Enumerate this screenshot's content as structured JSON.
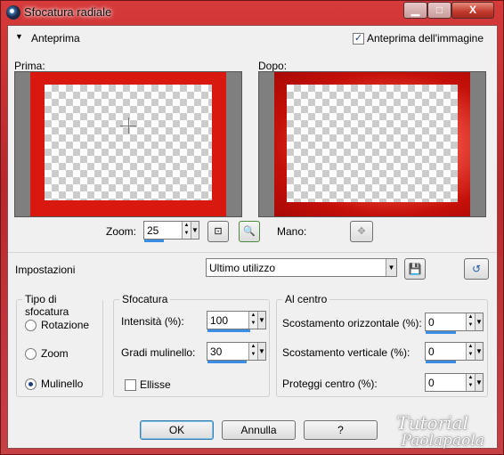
{
  "window": {
    "title": "Sfocatura radiale",
    "caption_min": "▁",
    "caption_max": "□",
    "caption_close": "X"
  },
  "preview": {
    "section_label": "Anteprima",
    "toggle_label": "Anteprima dell'immagine",
    "toggle_checked": true,
    "before_label": "Prima:",
    "after_label": "Dopo:"
  },
  "zoom": {
    "label": "Zoom:",
    "value": "25",
    "hand_label": "Mano:"
  },
  "settings": {
    "label": "Impostazioni",
    "preset": "Ultimo utilizzo"
  },
  "blur_type": {
    "title": "Tipo di sfocatura",
    "options": [
      "Rotazione",
      "Zoom",
      "Mulinello"
    ],
    "selected": "Mulinello"
  },
  "blur": {
    "title": "Sfocatura",
    "intensity_label": "Intensità (%):",
    "intensity_value": "100",
    "twirl_label": "Gradi mulinello:",
    "twirl_value": "30",
    "ellipse_label": "Ellisse",
    "ellipse_checked": false
  },
  "center": {
    "title": "Al centro",
    "h_offset_label": "Scostamento orizzontale (%):",
    "h_offset_value": "0",
    "v_offset_label": "Scostamento verticale (%):",
    "v_offset_value": "0",
    "protect_label": "Proteggi centro (%):",
    "protect_value": "0"
  },
  "buttons": {
    "ok": "OK",
    "cancel": "Annulla",
    "help": "?"
  },
  "watermark": {
    "line1": "Tutorial",
    "line2": "Paolapaola"
  },
  "colors": {
    "frame_red": "#d9190f",
    "title_bar": "#c7262b"
  }
}
